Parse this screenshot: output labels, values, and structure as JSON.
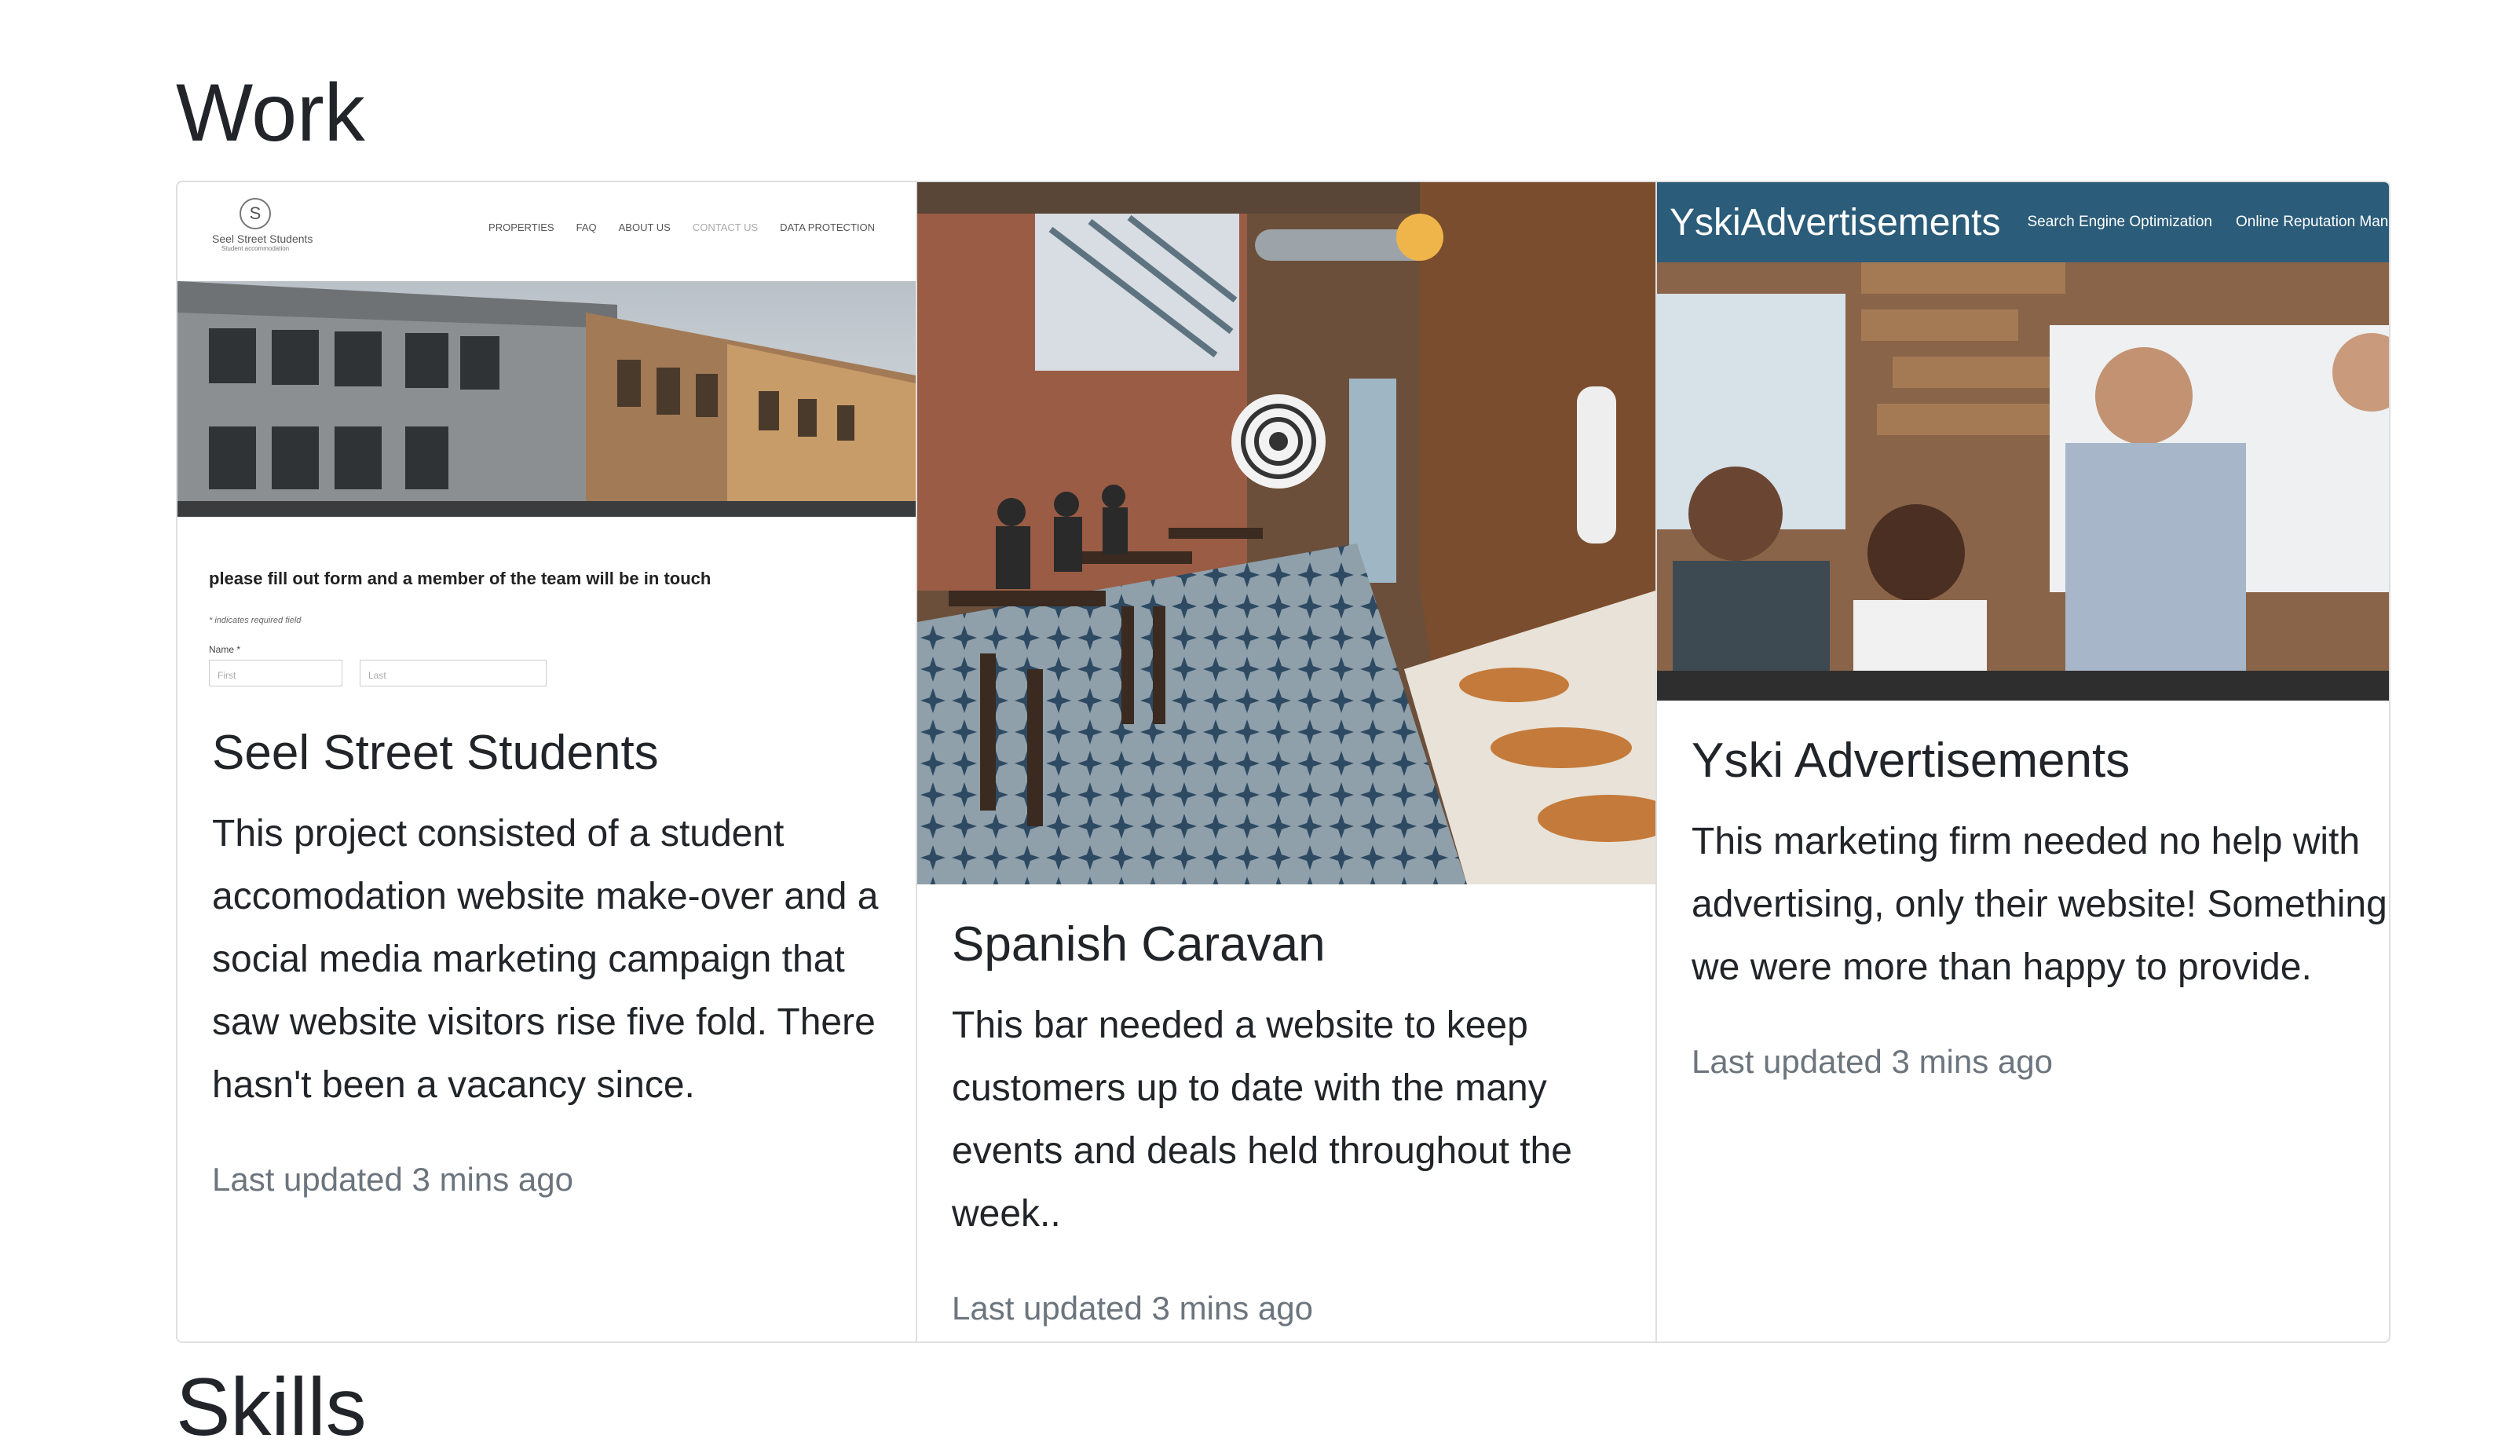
{
  "work": {
    "title": "Work",
    "cards": [
      {
        "title": "Seel Street Students",
        "text": "This project consisted of a student accomodation website make-over and a social media marketing campaign that saw website visitors rise five fold. There hasn't been a vacancy since.",
        "updated": "Last updated 3 mins ago",
        "image": {
          "logo_letter": "S",
          "logo_name": "Seel Street Students",
          "logo_tagline": "Student accommodation",
          "nav": [
            "PROPERTIES",
            "FAQ",
            "ABOUT US",
            "CONTACT US",
            "DATA PROTECTION"
          ],
          "form_title": "please fill out form and a member of the team will be in touch",
          "form_note": "* indicates required field",
          "form_label": "Name *",
          "field_first": "First",
          "field_last": "Last"
        }
      },
      {
        "title": "Spanish Caravan",
        "text": "This bar needed a website to keep customers up to date with the many events and deals held throughout the week..",
        "updated": "Last updated 3 mins ago"
      },
      {
        "title": "Yski Advertisements",
        "text": "This marketing firm needed no help with advertising, only their website! Something we were more than happy to provide.",
        "updated": "Last updated 3 mins ago",
        "image": {
          "brand": "YskiAdvertisements",
          "nav": [
            "Search Engine Optimization",
            "Online Reputation Management"
          ],
          "header_color": "#2b5c79"
        }
      }
    ]
  },
  "skills": {
    "title": "Skills"
  }
}
